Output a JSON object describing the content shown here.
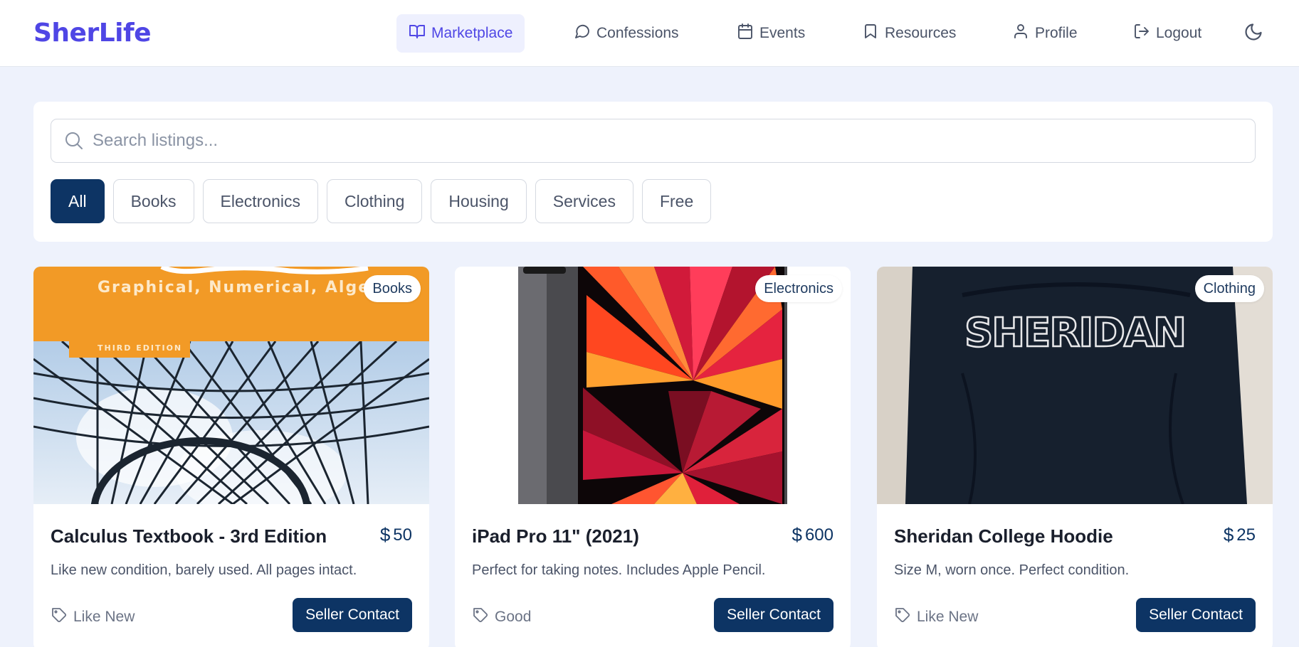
{
  "app": {
    "brand": "SherLife"
  },
  "nav": {
    "items": [
      {
        "label": "Marketplace",
        "icon": "book-open-icon",
        "active": true
      },
      {
        "label": "Confessions",
        "icon": "message-circle-icon"
      },
      {
        "label": "Events",
        "icon": "calendar-icon"
      },
      {
        "label": "Resources",
        "icon": "bookmark-icon"
      },
      {
        "label": "Profile",
        "icon": "user-icon"
      },
      {
        "label": "Logout",
        "icon": "logout-icon"
      }
    ],
    "theme_toggle_icon": "moon-icon"
  },
  "search": {
    "placeholder": "Search listings...",
    "value": ""
  },
  "filters": {
    "categories": [
      "All",
      "Books",
      "Electronics",
      "Clothing",
      "Housing",
      "Services",
      "Free"
    ],
    "selected": "All"
  },
  "listings": [
    {
      "category": "Books",
      "title": "Calculus Textbook - 3rd Edition",
      "currency_symbol": "$",
      "price": "50",
      "description": "Like new condition, barely used. All pages intact.",
      "condition": "Like New",
      "action_label": "Seller Contact",
      "image_text": {
        "subtitle": "Graphical, Numerical, Alge",
        "edition": "THIRD EDITION"
      }
    },
    {
      "category": "Electronics",
      "title": "iPad Pro 11\" (2021)",
      "currency_symbol": "$",
      "price": "600",
      "description": "Perfect for taking notes. Includes Apple Pencil.",
      "condition": "Good",
      "action_label": "Seller Contact"
    },
    {
      "category": "Clothing",
      "title": "Sheridan College Hoodie",
      "currency_symbol": "$",
      "price": "25",
      "description": "Size M, worn once. Perfect condition.",
      "condition": "Like New",
      "action_label": "Seller Contact",
      "image_text": {
        "print": "SHERIDAN"
      }
    }
  ],
  "colors": {
    "brand": "#4f46e5",
    "primary": "#0d3464",
    "background": "#eef2fc"
  }
}
